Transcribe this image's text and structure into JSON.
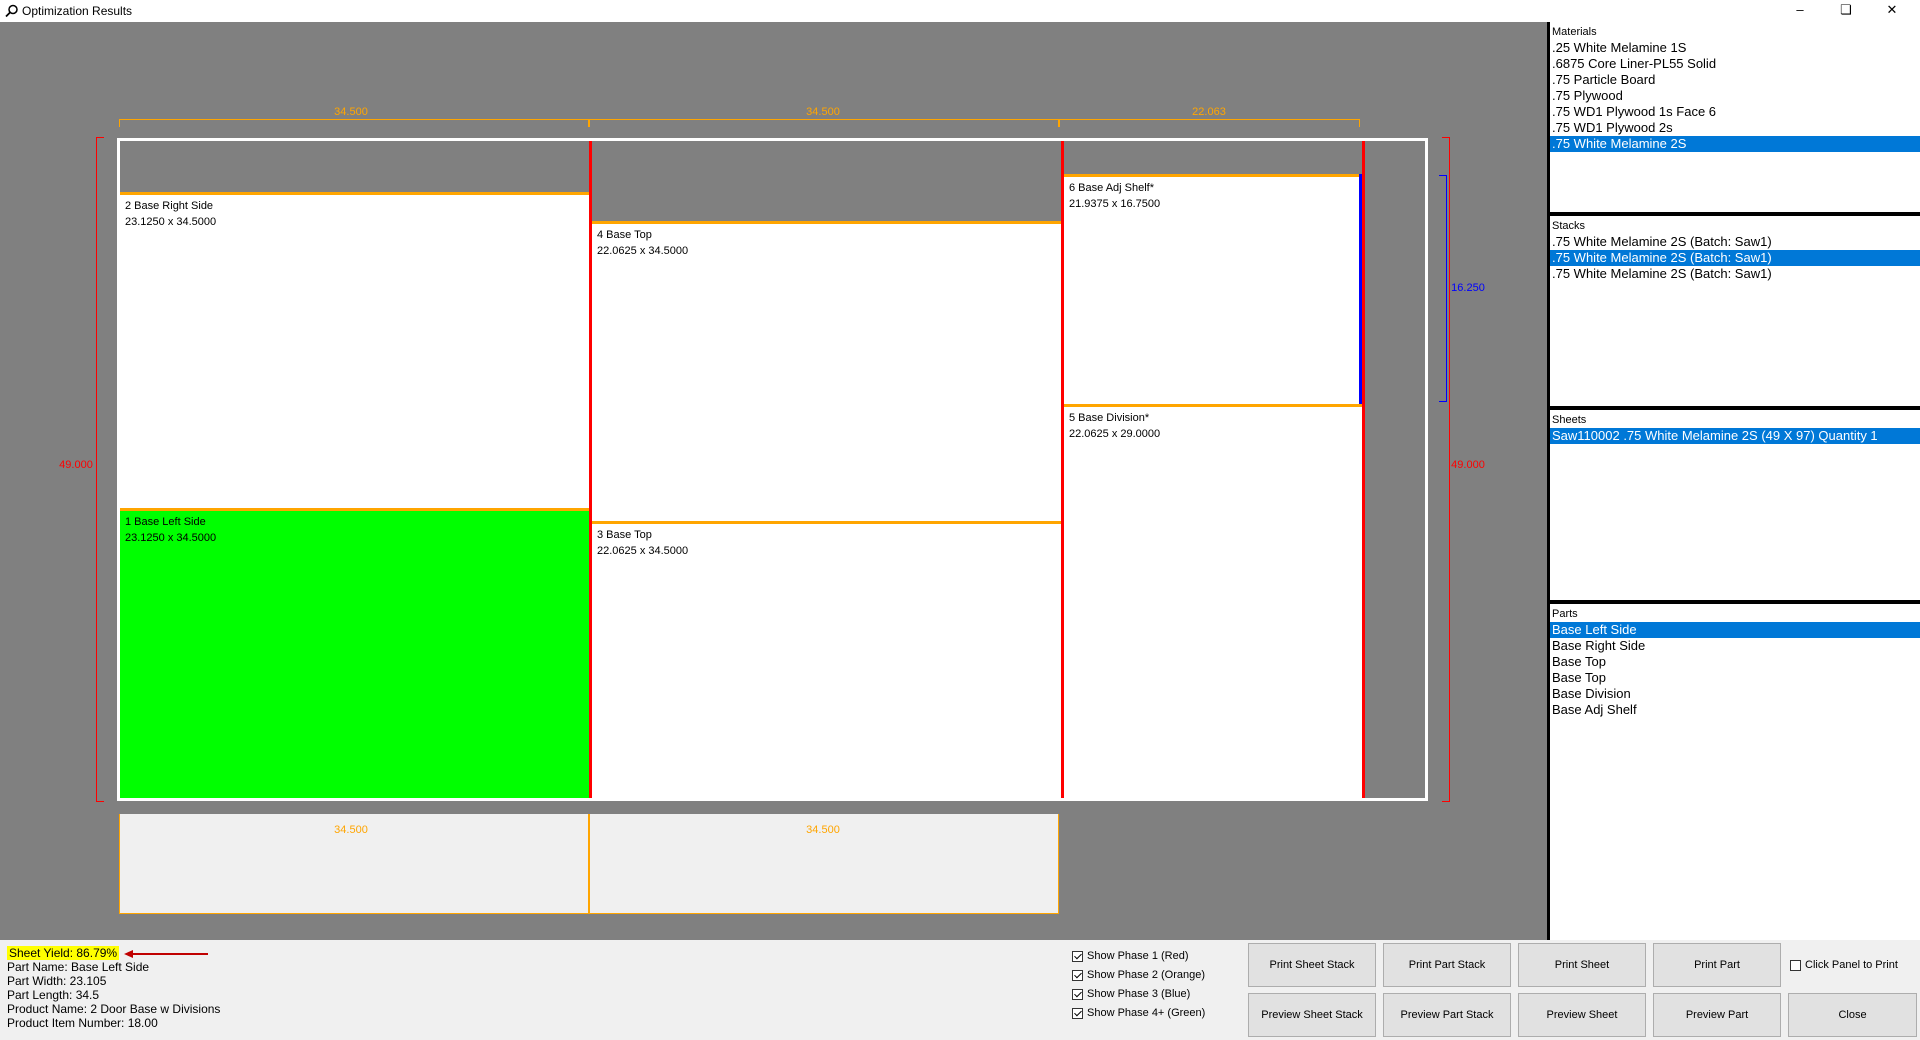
{
  "window": {
    "title": "Optimization Results",
    "minimize_label": "–",
    "restore_label": "❏",
    "close_label": "✕"
  },
  "sheet": {
    "top_dims": [
      "34.500",
      "34.500",
      "22.063"
    ],
    "bottom_dims": [
      "34.500",
      "34.500"
    ],
    "left_dim": "49.000",
    "right_dim": "49.000",
    "shelf_dim": "16.250",
    "parts": [
      {
        "name": "2 Base Right Side",
        "size": "23.1250 x 34.5000",
        "color": "#ffffff"
      },
      {
        "name": "1 Base Left Side",
        "size": "23.1250 x 34.5000",
        "color": "#00ff00"
      },
      {
        "name": "4 Base Top",
        "size": "22.0625 x 34.5000",
        "color": "#ffffff"
      },
      {
        "name": "3 Base Top",
        "size": "22.0625 x 34.5000",
        "color": "#ffffff"
      },
      {
        "name": "6 Base Adj Shelf*",
        "size": "21.9375 x 16.7500",
        "color": "#ffffff"
      },
      {
        "name": "5 Base Division*",
        "size": "22.0625 x 29.0000",
        "color": "#ffffff"
      }
    ]
  },
  "materials": {
    "header": "Materials",
    "items": [
      ".25 White Melamine 1S",
      ".6875 Core Liner-PL55 Solid",
      ".75 Particle Board",
      ".75 Plywood",
      ".75 WD1 Plywood 1s Face 6",
      ".75 WD1 Plywood 2s",
      ".75 White Melamine 2S"
    ],
    "selected_index": 6
  },
  "stacks": {
    "header": "Stacks",
    "items": [
      ".75 White Melamine 2S (Batch: Saw1)",
      ".75 White Melamine 2S (Batch: Saw1)",
      ".75 White Melamine 2S (Batch: Saw1)"
    ],
    "selected_index": 1
  },
  "sheets": {
    "header": "Sheets",
    "items": [
      "Saw110002 .75 White Melamine 2S (49 X 97)  Quantity 1"
    ],
    "selected_index": 0
  },
  "parts": {
    "header": "Parts",
    "items": [
      "Base Left Side",
      "Base Right Side",
      "Base Top",
      "Base Top",
      "Base Division",
      "Base Adj Shelf"
    ],
    "selected_index": 0
  },
  "info": {
    "sheet_yield": "Sheet Yield:  86.79%",
    "part_name": "Part Name:  Base Left Side",
    "part_width": "Part Width:  23.105",
    "part_length": "Part Length:  34.5",
    "product_name": "Product Name:  2 Door Base w Divisions",
    "product_item_number": "Product Item Number:  18.00"
  },
  "phases": [
    {
      "label": "Show Phase 1 (Red)",
      "checked": true
    },
    {
      "label": "Show Phase 2 (Orange)",
      "checked": true
    },
    {
      "label": "Show Phase 3 (Blue)",
      "checked": true
    },
    {
      "label": "Show Phase 4+ (Green)",
      "checked": true
    }
  ],
  "buttons": {
    "print_sheet_stack": "Print Sheet Stack",
    "print_part_stack": "Print Part Stack",
    "print_sheet": "Print Sheet",
    "print_part": "Print Part",
    "click_panel_to_print": "Click Panel to Print",
    "preview_sheet_stack": "Preview Sheet Stack",
    "preview_part_stack": "Preview Part Stack",
    "preview_sheet": "Preview Sheet",
    "preview_part": "Preview Part",
    "close": "Close"
  },
  "colors": {
    "phase1": "#ff0000",
    "phase2": "#ffa500",
    "phase3": "#0000ff",
    "selected_part": "#00ff00",
    "highlight": "#ffff00",
    "selection": "#0078d7"
  }
}
